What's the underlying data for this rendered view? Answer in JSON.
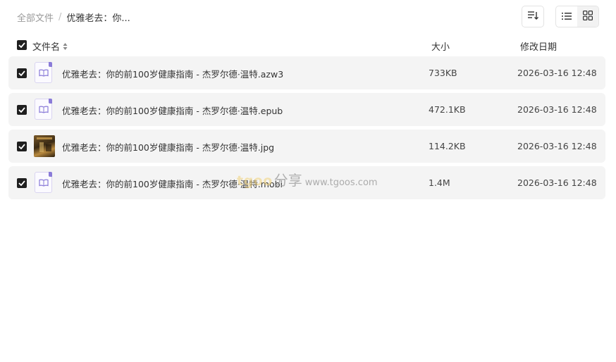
{
  "breadcrumb": {
    "root": "全部文件",
    "separator": "/",
    "current": "优雅老去：你..."
  },
  "toolbar": {
    "sort_icon": "sort-icon",
    "list_view_icon": "list-view-icon",
    "grid_view_icon": "grid-view-icon",
    "active_view": "grid"
  },
  "table": {
    "headers": {
      "name": "文件名",
      "size": "大小",
      "date": "修改日期"
    },
    "select_all_checked": true,
    "rows": [
      {
        "checked": true,
        "icon": "ebook-file-icon",
        "name": "优雅老去：你的前100岁健康指南 - 杰罗尔德·温特.azw3",
        "size": "733KB",
        "date": "2026-03-16 12:48"
      },
      {
        "checked": true,
        "icon": "ebook-file-icon",
        "name": "优雅老去：你的前100岁健康指南 - 杰罗尔德·温特.epub",
        "size": "472.1KB",
        "date": "2026-03-16 12:48"
      },
      {
        "checked": true,
        "icon": "image-thumbnail",
        "name": "优雅老去：你的前100岁健康指南 - 杰罗尔德·温特.jpg",
        "size": "114.2KB",
        "date": "2026-03-16 12:48"
      },
      {
        "checked": true,
        "icon": "ebook-file-icon",
        "name": "优雅老去：你的前100岁健康指南 - 杰罗尔德·温特.mobi",
        "size": "1.4M",
        "date": "2026-03-16 12:48"
      }
    ]
  },
  "watermark": {
    "logo": "tgoo",
    "share": "分享",
    "url": "www.tgoos.com"
  },
  "colors": {
    "row_background": "#f4f4f4",
    "checkbox": "#1f1f1f",
    "file_icon_accent": "#8a7bd8",
    "muted_text": "#9a9a9a"
  }
}
